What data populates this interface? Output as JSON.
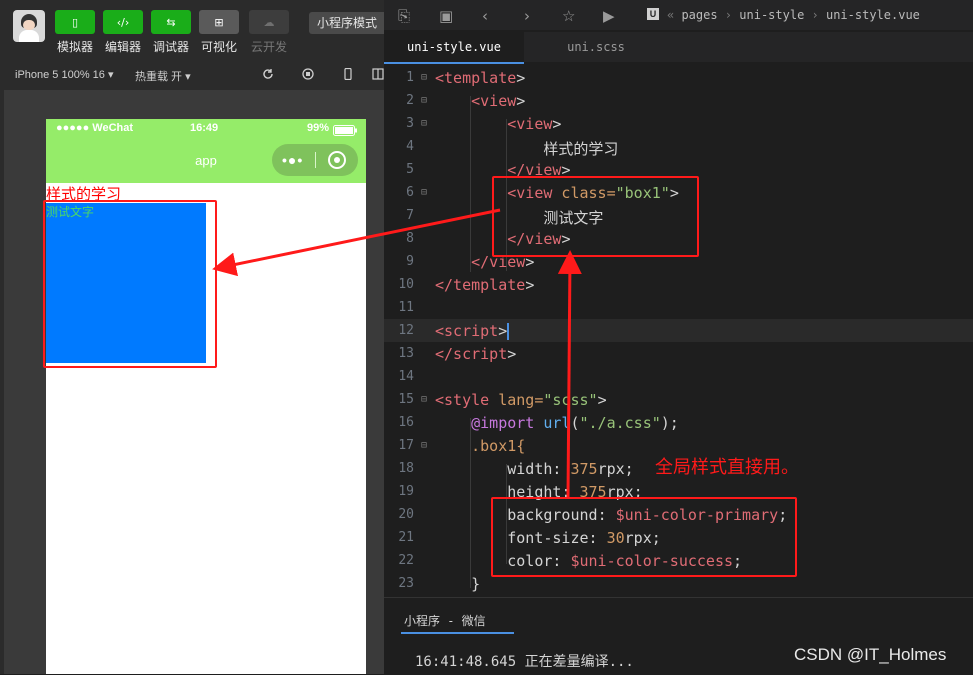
{
  "devtools": {
    "toolbar": [
      {
        "label": "模拟器",
        "icon": "phone-icon"
      },
      {
        "label": "编辑器",
        "icon": "code-icon"
      },
      {
        "label": "调试器",
        "icon": "debug-icon"
      },
      {
        "label": "可视化",
        "icon": "layout-icon"
      },
      {
        "label": "云开发",
        "icon": "cloud-icon"
      }
    ],
    "mode": "小程序模式",
    "device": "iPhone 5 100% 16 ▾",
    "hot_reload": "热重载 开 ▾"
  },
  "phone": {
    "carrier": "●●●●● WeChat",
    "time": "16:49",
    "battery": "99%",
    "nav_title": "app",
    "capsule_dots": "•●•",
    "heading": "样式的学习",
    "box_text": "测试文字",
    "colors": {
      "navbar": "#95ec69",
      "box": "#007aff",
      "box_text": "#4cd964",
      "heading": "#ff0000"
    }
  },
  "editor": {
    "breadcrumb": [
      "pages",
      "uni-style",
      "uni-style.vue"
    ],
    "tabs": [
      {
        "label": "uni-style.vue",
        "active": true
      },
      {
        "label": "uni.scss",
        "active": false
      }
    ],
    "line_numbers": [
      "1",
      "2",
      "3",
      "4",
      "5",
      "6",
      "7",
      "8",
      "9",
      "10",
      "11",
      "12",
      "13",
      "14",
      "15",
      "16",
      "17",
      "18",
      "19",
      "20",
      "21",
      "22",
      "23"
    ],
    "code": {
      "l1a": "<template",
      "l1b": ">",
      "l2a": "<view",
      "l2b": ">",
      "l3a": "<view",
      "l3b": ">",
      "l4": "样式的学习",
      "l5a": "</view",
      "l5b": ">",
      "l6a": "<view",
      "l6b": " class=",
      "l6c": "\"box1\"",
      "l6d": ">",
      "l7": "测试文字",
      "l8a": "</view",
      "l8b": ">",
      "l9a": "</view",
      "l9b": ">",
      "l10a": "</template",
      "l10b": ">",
      "l12a": "<script",
      "l12b": ">",
      "l13a": "</script",
      "l13b": ">",
      "l15a": "<style",
      "l15b": " lang=",
      "l15c": "\"scss\"",
      "l15d": ">",
      "l16a": "@import",
      "l16b": " url",
      "l16c": "(",
      "l16d": "\"./a.css\"",
      "l16e": ");",
      "l17": ".box1{",
      "l18a": "width",
      "l18b": ": ",
      "l18c": "375",
      "l18d": "rpx;",
      "l19a": "height",
      "l19b": ": ",
      "l19c": "375",
      "l19d": "rpx;",
      "l20a": "background",
      "l20b": ": ",
      "l20c": "$uni-color-primary",
      "l20d": ";",
      "l21a": "font-size",
      "l21b": ": ",
      "l21c": "30",
      "l21d": "rpx;",
      "l22a": "color",
      "l22b": ": ",
      "l22c": "$uni-color-success",
      "l22d": ";",
      "l23": "}"
    },
    "console_tab": "小程序 - 微信",
    "console_log": "16:41:48.645 正在差量编译..."
  },
  "annotation": "全局样式直接用。",
  "watermark": "CSDN @IT_Holmes"
}
